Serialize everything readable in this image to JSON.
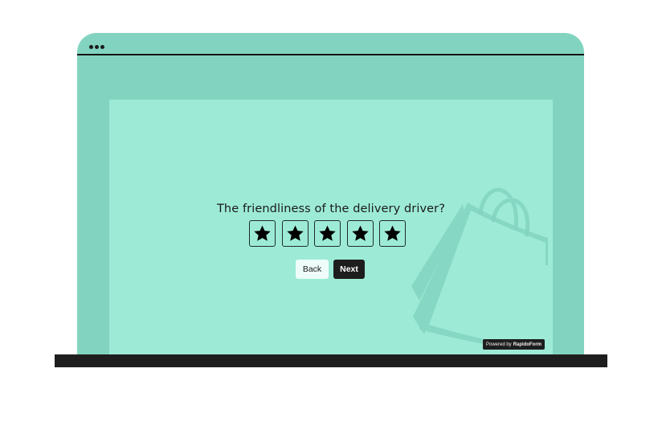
{
  "window": {
    "dots_count": 3
  },
  "survey": {
    "question": "The friendliness of the delivery driver?",
    "rating": {
      "max_stars": 5,
      "selected": 0,
      "star_icon": "star-icon"
    },
    "buttons": {
      "back_label": "Back",
      "next_label": "Next"
    }
  },
  "branding": {
    "powered_prefix": "Powered by",
    "powered_brand": "RapidoForm",
    "background_illustration": "shopping-bag-icon"
  },
  "colors": {
    "frame": "#82d4c0",
    "panel": "#9debd6",
    "dark": "#1e1e1e",
    "back_button_bg": "#eefdf9"
  }
}
